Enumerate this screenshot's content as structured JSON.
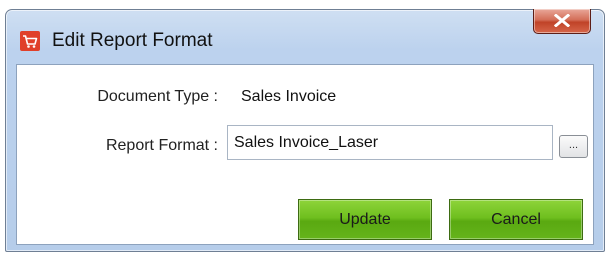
{
  "window": {
    "title": "Edit Report Format",
    "app_icon": "cart-icon",
    "close_icon": "close-icon"
  },
  "form": {
    "document_type_label": "Document Type :",
    "document_type_value": "Sales Invoice",
    "report_format_label": "Report Format :",
    "report_format_value": "Sales Invoice_Laser",
    "browse_label": "..."
  },
  "buttons": {
    "update_label": "Update",
    "cancel_label": "Cancel"
  },
  "colors": {
    "title_bar": "#bcd2ee",
    "close_button": "#c04328",
    "action_button": "#6fbf1f"
  }
}
